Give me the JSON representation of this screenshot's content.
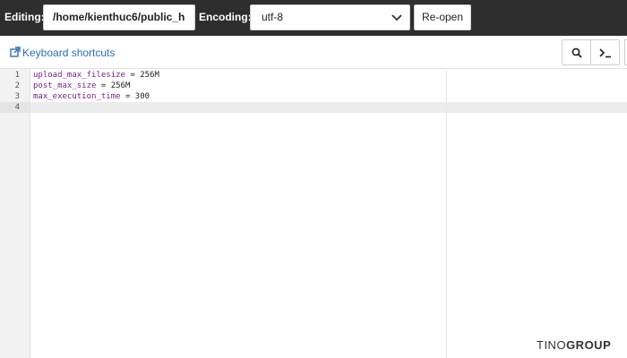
{
  "toolbar": {
    "editing_label": "Editing:",
    "file_path": "/home/kienthuc6/public_h",
    "encoding_label": "Encoding:",
    "encoding_value": "utf-8",
    "reopen_label": "Re-open"
  },
  "subtoolbar": {
    "keyboard_shortcuts_label": "Keyboard shortcuts",
    "link_icon": "external-link-icon",
    "search_icon": "search-icon",
    "terminal_icon": "terminal-icon"
  },
  "editor": {
    "line_numbers": [
      "1",
      "2",
      "3",
      "4"
    ],
    "lines": [
      {
        "key": "upload_max_filesize",
        "rest": " = 256M"
      },
      {
        "key": "post_max_size",
        "rest": " = 256M"
      },
      {
        "key": "max_execution_time",
        "rest": " = 300"
      },
      {
        "key": "",
        "rest": ""
      }
    ],
    "active_line": 4
  },
  "watermark": {
    "part1": "TINO",
    "part2": "GROUP"
  },
  "colors": {
    "toolbar_bg": "#2e2e2e",
    "link": "#2a6fb7",
    "code_key": "#7a1f8f"
  }
}
